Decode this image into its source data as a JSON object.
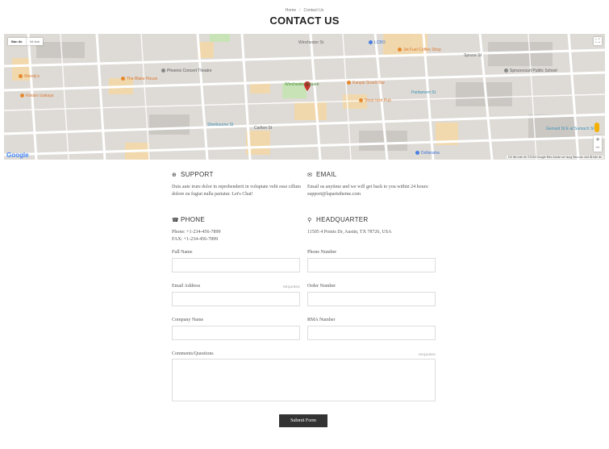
{
  "breadcrumb": {
    "home": "Home",
    "separator": "/",
    "current": "Contact Us"
  },
  "page_title": "CONTACT US",
  "map": {
    "map_type_options": [
      "Bản đồ",
      "Vệ tinh"
    ],
    "google_logo": "Google",
    "attribution": "Dữ liệu bản đồ ©2018 Google   Điều khoản sử dụng   Báo cáo một lỗi bản đồ",
    "zoom_in": "+",
    "zoom_out": "−",
    "places": {
      "lcbo": "LCBO",
      "coffee": "Jet Fuel Coffee Shop",
      "woodys": "Woody's",
      "blake": "The Blake House",
      "phoenix": "Phoenix Concert Theatre",
      "kintaro": "Kintaro Izakaya",
      "winchester": "Winchester Square",
      "kanpai": "Kanpai Snack Bar",
      "stout": "Stout Irish Pub",
      "spruce": "Sprucecourt Public School",
      "dollarama": "Dollarama",
      "gerrard": "Gerrard St E at Sumach St"
    },
    "streets": {
      "carlton": "Carlton St",
      "winchester_st": "Winchester St",
      "spruce_st": "Spruce St",
      "parliament": "Parliament St",
      "sherbourne": "Sherbourne St"
    },
    "accent_color": "#c5322d"
  },
  "support": {
    "title": "SUPPORT",
    "icon": "lifebuoy-icon",
    "text": "Duis aute irure dolor in reprehenderit in voluptate velit esse cillum dolore eu fugiat nulla pariatur. Let's Chat!"
  },
  "email": {
    "title": "EMAIL",
    "icon": "envelope-icon",
    "text": "Email us anytime and we will get back to you within 24 hours: support@laparistheme.com"
  },
  "phone": {
    "title": "PHONE",
    "icon": "phone-icon",
    "line1": "Phone: +1-234-456-7899",
    "line2": "FAX: +1-234-456-7899"
  },
  "headquarter": {
    "title": "HEADQUARTER",
    "icon": "map-marker-icon",
    "text": "11505 4 Points Dr, Austin, TX 78726, USA"
  },
  "form": {
    "full_name": {
      "label": "Full Name",
      "value": ""
    },
    "phone_number": {
      "label": "Phone Number",
      "value": ""
    },
    "email_address": {
      "label": "Email Address",
      "required": "REQUIRED",
      "value": ""
    },
    "order_number": {
      "label": "Order Number",
      "value": ""
    },
    "company_name": {
      "label": "Company Name",
      "value": ""
    },
    "rma_number": {
      "label": "RMA Number",
      "value": ""
    },
    "comments": {
      "label": "Comments/Questions",
      "required": "REQUIRED",
      "value": ""
    },
    "submit_label": "Submit Form"
  }
}
